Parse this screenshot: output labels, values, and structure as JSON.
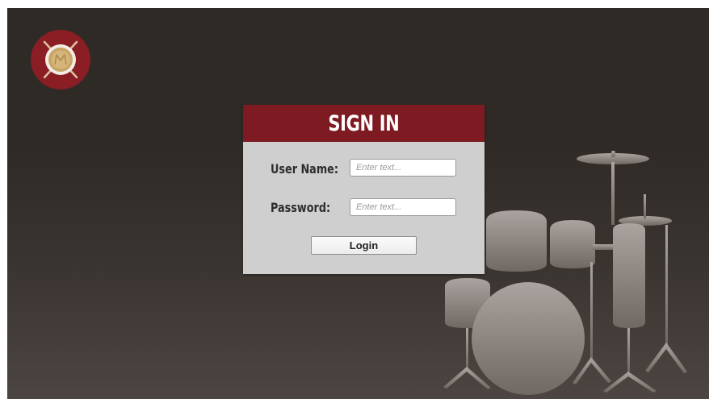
{
  "app": {
    "logo_icon": "drumsticks-crest-icon",
    "background_icon": "drum-kit-silhouette-icon",
    "accent_color": "#7e1a22"
  },
  "signin": {
    "title": "SIGN IN",
    "username": {
      "label": "User Name:",
      "placeholder": "Enter text...",
      "value": ""
    },
    "password": {
      "label": "Password:",
      "placeholder": "Enter text...",
      "value": ""
    },
    "login_label": "Login"
  }
}
